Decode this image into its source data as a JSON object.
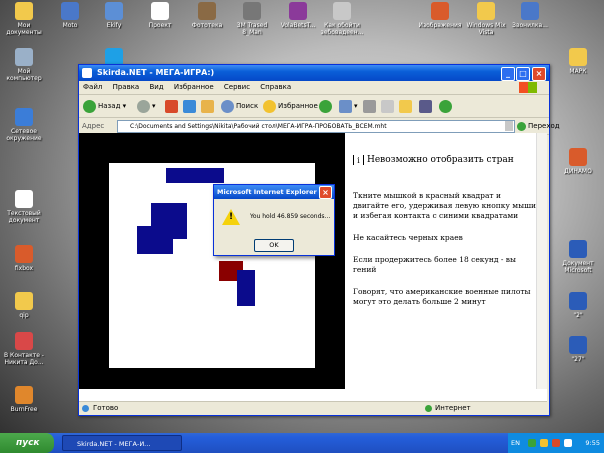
{
  "desktop": {
    "icons": [
      {
        "label": "Мои документы",
        "color": "#f2c94c",
        "icon": "folder-icon"
      },
      {
        "label": "Мой компьютер",
        "color": "#9ab0c8",
        "icon": "computer-icon"
      },
      {
        "label": "Сетевое окружение",
        "color": "#3b7dd8",
        "icon": "network-icon"
      },
      {
        "label": "Текстовый документ",
        "color": "#ffffff",
        "icon": "document-icon"
      },
      {
        "label": "fixbox",
        "color": "#d95b2b",
        "icon": "app-icon"
      },
      {
        "label": "qip",
        "color": "#f2c94c",
        "icon": "folder-icon"
      },
      {
        "label": "В Контакте - Никита До...",
        "color": "#d94848",
        "icon": "app-icon"
      },
      {
        "label": "BurnFree",
        "color": "#e0872c",
        "icon": "app-icon"
      },
      {
        "label": "Moto",
        "color": "#4a78c9",
        "icon": "app-icon"
      },
      {
        "label": "Skype",
        "color": "#1ea0e6",
        "icon": "skype-icon"
      },
      {
        "label": "Ekify",
        "color": "#5c8fd6",
        "icon": "app-icon"
      },
      {
        "label": "Проект",
        "color": "#ffffff",
        "icon": "document-icon"
      },
      {
        "label": "Фототека",
        "color": "#8a6a45",
        "icon": "app-icon"
      },
      {
        "label": "3M Trased 8_Man",
        "color": "#777777",
        "icon": "app-icon"
      },
      {
        "label": "VolaBetsT...",
        "color": "#8b3a9a",
        "icon": "archive-icon"
      },
      {
        "label": "Как обойти зебовадеен...",
        "color": "#c8c8c8",
        "icon": "app-icon"
      },
      {
        "label": "Изображения",
        "color": "#d95b2b",
        "icon": "document-icon"
      },
      {
        "label": "Windows Mix Vista",
        "color": "#f2c94c",
        "icon": "folder-icon"
      },
      {
        "label": "Звонилка...",
        "color": "#4a78c9",
        "icon": "app-icon"
      },
      {
        "label": "МАРК",
        "color": "#f2c94c",
        "icon": "folder-icon"
      },
      {
        "label": "ДИНАМО",
        "color": "#d95b2b",
        "icon": "document-icon"
      },
      {
        "label": "Документ Microsoft Word",
        "color": "#2b5cb8",
        "icon": "word-icon"
      },
      {
        "label": "\"2\"",
        "color": "#2b5cb8",
        "icon": "word-icon"
      },
      {
        "label": "\"27\"",
        "color": "#2b5cb8",
        "icon": "word-icon"
      }
    ]
  },
  "window": {
    "title": "Skirda.NET - МЕГА-ИГРА:)",
    "menu": [
      "Файл",
      "Правка",
      "Вид",
      "Избранное",
      "Сервис",
      "Справка"
    ],
    "toolbar": {
      "back": "Назад",
      "search": "Поиск",
      "favorites": "Избранное"
    },
    "address_label": "Адрес",
    "address_value": "C:\\Documents and Settings\\Nikita\\Рабочий стол\\МЕГА-ИГРА-ПРОБОВАТЬ_ВСЕМ.mht",
    "go_label": "Переход",
    "status_left": "Готово",
    "status_right": "Интернет"
  },
  "page": {
    "heading": "Невозможно отобразить стран",
    "paragraphs": [
      "Ткните мышкой в красный квадрат и двигайте его, удерживая левую кнопку мыши и избегая контакта с синими квадратами",
      "Не касайтесь черных краев",
      "Если продержитесь более 18 секунд - вы гений",
      "Говорят, что американские военные пилоты могут это делать больше 2 минут"
    ]
  },
  "dialog": {
    "title": "Microsoft Internet Explorer",
    "message": "You hold 46.859 seconds...",
    "ok_label": "OK"
  },
  "taskbar": {
    "start_label": "пуск",
    "task_label": "Skirda.NET - МЕГА-И...",
    "lang": "EN",
    "clock": "9:55"
  },
  "colors": {
    "blue_square": "#0b0b8c",
    "red_square": "#8a0000"
  }
}
